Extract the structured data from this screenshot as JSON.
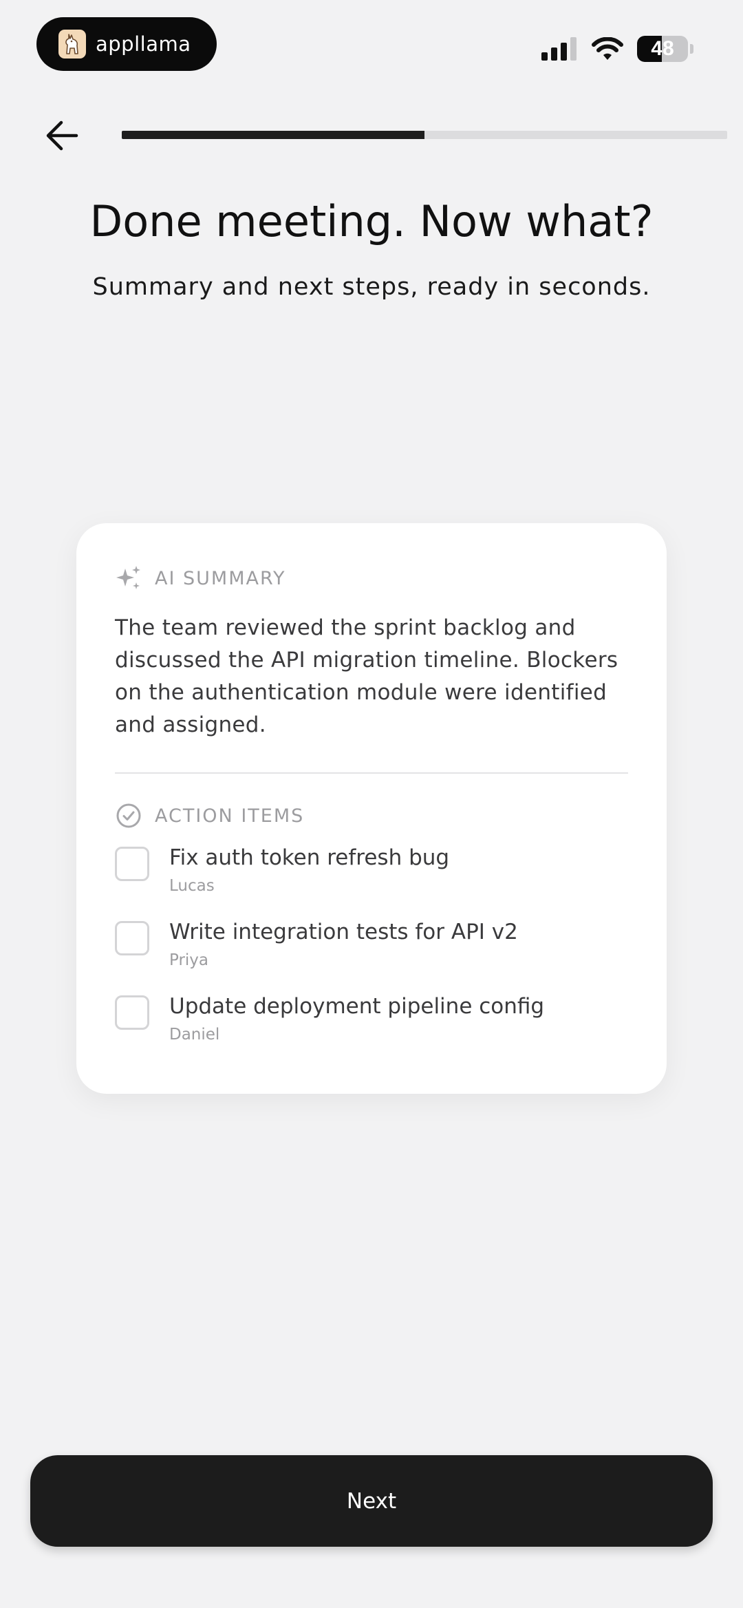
{
  "status_bar": {
    "brand_name": "appllama",
    "brand_icon": "llama-icon",
    "battery_level": "48",
    "icons": [
      "signal-icon",
      "wifi-icon",
      "battery-icon"
    ]
  },
  "header": {
    "back_icon": "arrow-left-icon",
    "progress_fraction": 0.5
  },
  "hero": {
    "title": "Done meeting. Now what?",
    "subtitle": "Summary and next steps, ready in seconds."
  },
  "card": {
    "summary": {
      "icon": "sparkles-icon",
      "label": "AI SUMMARY",
      "text": "The team reviewed the sprint backlog and discussed the API migration timeline. Blockers on the authentication module were identified and assigned."
    },
    "actions": {
      "icon": "check-circle-icon",
      "label": "ACTION ITEMS",
      "items": [
        {
          "title": "Fix auth token refresh bug",
          "owner": "Lucas",
          "checked": false
        },
        {
          "title": "Write integration tests for API v2",
          "owner": "Priya",
          "checked": false
        },
        {
          "title": "Update deployment pipeline config",
          "owner": "Daniel",
          "checked": false
        }
      ]
    }
  },
  "footer": {
    "next_label": "Next"
  },
  "colors": {
    "background": "#f2f2f3",
    "card": "#ffffff",
    "primary": "#1c1c1c",
    "muted_text": "#9c9c9f",
    "body_text": "#3a3a3c",
    "progress_track": "#dcdcde"
  }
}
